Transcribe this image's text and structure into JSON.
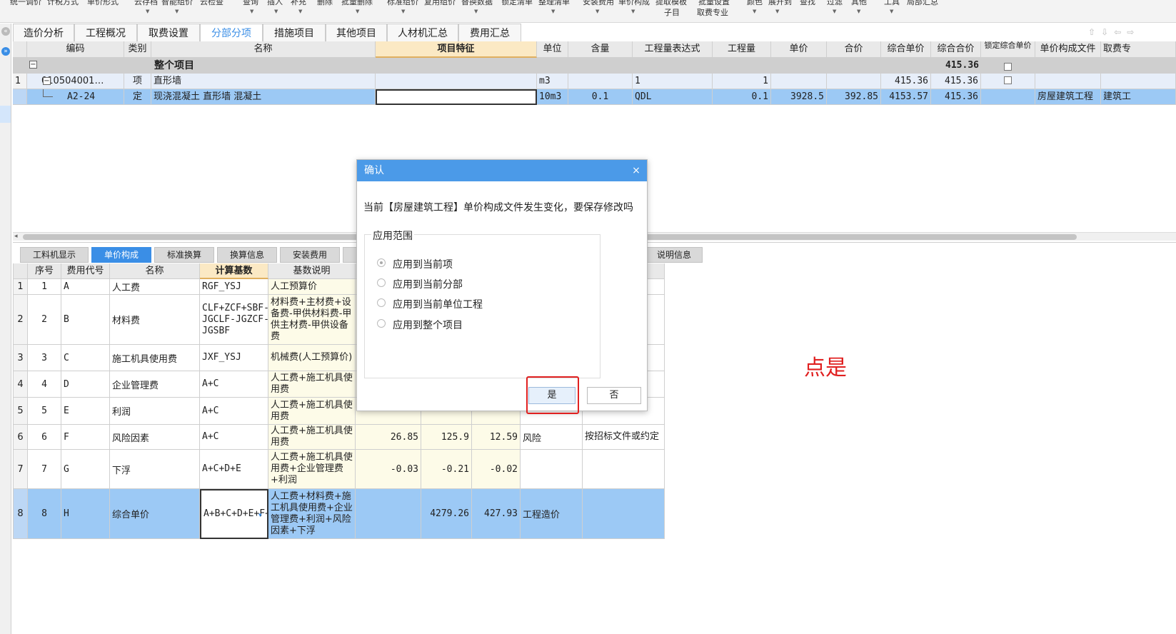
{
  "toolbar": {
    "items": [
      "统一调价",
      "计税方式",
      "单价形式",
      "云存档",
      "智能组价",
      "云检查",
      "查询",
      "插入",
      "补充",
      "删除",
      "批量删除",
      "标准组价",
      "复用组价",
      "替换数据",
      "锁定清单",
      "整理清单",
      "安装费用",
      "单价构成",
      "提取模板",
      "子目",
      "批量设置",
      "取费专业",
      "颜色",
      "展开到",
      "查找",
      "过滤",
      "其他",
      "工具",
      "局部汇总"
    ]
  },
  "tabs": [
    "造价分析",
    "工程概况",
    "取费设置",
    "分部分项",
    "措施项目",
    "其他项目",
    "人材机汇总",
    "费用汇总"
  ],
  "active_tab": "分部分项",
  "top_grid": {
    "headers": [
      "编码",
      "类别",
      "名称",
      "项目特征",
      "单位",
      "含量",
      "工程量表达式",
      "工程量",
      "单价",
      "合价",
      "综合单价",
      "综合合价",
      "锁定综合单价",
      "单价构成文件",
      "取费专"
    ],
    "summary_row": {
      "label": "整个项目",
      "total": "415.36"
    },
    "rows": [
      {
        "no": "1",
        "code": "010504001…",
        "type": "项",
        "name": "直形墙",
        "feature": "",
        "unit": "m3",
        "content": "",
        "expr": "1",
        "qty": "1",
        "price": "",
        "amount": "",
        "unit_price": "415.36",
        "total": "415.36",
        "file": "",
        "fee": ""
      },
      {
        "no": "",
        "code": "A2-24",
        "type": "定",
        "name": "现浇混凝土 直形墙 混凝土",
        "feature": "",
        "unit": "10m3",
        "content": "0.1",
        "expr": "QDL",
        "qty": "0.1",
        "price": "3928.5",
        "amount": "392.85",
        "unit_price": "4153.57",
        "total": "415.36",
        "file": "房屋建筑工程",
        "fee": "建筑工"
      }
    ]
  },
  "bottom_tabs": [
    "工料机显示",
    "单价构成",
    "标准换算",
    "换算信息",
    "安装费用",
    "说明信息"
  ],
  "bottom_active_tab": "单价构成",
  "bottom_grid": {
    "headers": [
      "序号",
      "费用代号",
      "名称",
      "计算基数",
      "基数说明"
    ],
    "rows": [
      {
        "row": "1",
        "no": "1",
        "code": "A",
        "name": "人工费",
        "base": "RGF_YSJ",
        "desc": "人工预算价",
        "rate": "",
        "amount": "",
        "total": "",
        "cat": "",
        "note": ""
      },
      {
        "row": "2",
        "no": "2",
        "code": "B",
        "name": "材料费",
        "base": "CLF+ZCF+SBF-JGCLF-JGZCF-JGSBF",
        "desc": "材料费+主材费+设备费-甲供材料费-甲供主材费-甲供设备费",
        "rate": "",
        "amount": "",
        "total": "",
        "cat": "",
        "note": ""
      },
      {
        "row": "3",
        "no": "3",
        "code": "C",
        "name": "施工机具使用费",
        "base": "JXF_YSJ",
        "desc": "机械费(人工预算价)",
        "rate": "",
        "amount": "",
        "total": "",
        "cat": "",
        "note": ""
      },
      {
        "row": "4",
        "no": "4",
        "code": "D",
        "name": "企业管理费",
        "base": "A+C",
        "desc": "人工费+施工机具使用费",
        "rate": "",
        "amount": "",
        "total": "",
        "cat": "",
        "note": ""
      },
      {
        "row": "5",
        "no": "5",
        "code": "E",
        "name": "利润",
        "base": "A+C",
        "desc": "人工费+施工机具使用费",
        "rate": "",
        "amount": "",
        "total": "",
        "cat": "",
        "note": ""
      },
      {
        "row": "6",
        "no": "6",
        "code": "F",
        "name": "风险因素",
        "base": "A+C",
        "desc": "人工费+施工机具使用费",
        "rate": "26.85",
        "amount": "125.9",
        "total": "12.59",
        "cat": "风险",
        "note": "按招标文件或约定"
      },
      {
        "row": "7",
        "no": "7",
        "code": "G",
        "name": "下浮",
        "base": "A+C+D+E",
        "desc": "人工费+施工机具使用费+企业管理费+利润",
        "rate": "-0.03",
        "amount": "-0.21",
        "total": "-0.02",
        "cat": "",
        "note": ""
      },
      {
        "row": "8",
        "no": "8",
        "code": "H",
        "name": "综合单价",
        "base": "A+B+C+D+E+F+G",
        "desc": "人工费+材料费+施工机具使用费+企业管理费+利润+风险因素+下浮",
        "rate": "",
        "amount": "4279.26",
        "total": "427.93",
        "cat": "工程造价",
        "note": ""
      }
    ]
  },
  "dialog": {
    "title": "确认",
    "close": "×",
    "message": "当前【房屋建筑工程】单价构成文件发生变化，要保存修改吗",
    "group_label": "应用范围",
    "options": [
      "应用到当前项",
      "应用到当前分部",
      "应用到当前单位工程",
      "应用到整个项目"
    ],
    "selected_index": 0,
    "yes_label": "是",
    "no_label": "否"
  },
  "annotation": {
    "text": "点是",
    "color": "#e02020",
    "box_color": "#e02020"
  }
}
